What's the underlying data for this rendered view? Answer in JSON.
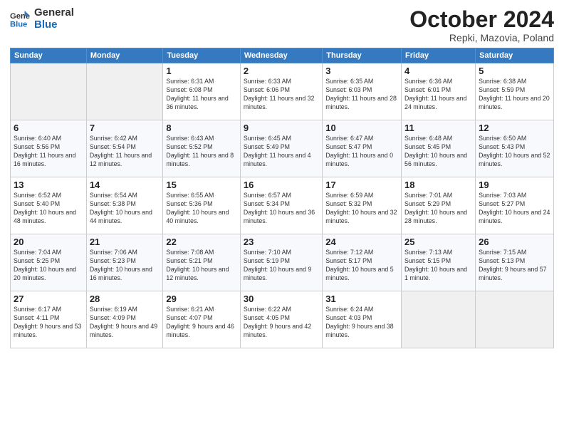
{
  "header": {
    "logo_line1": "General",
    "logo_line2": "Blue",
    "title": "October 2024",
    "subtitle": "Repki, Mazovia, Poland"
  },
  "calendar": {
    "days_of_week": [
      "Sunday",
      "Monday",
      "Tuesday",
      "Wednesday",
      "Thursday",
      "Friday",
      "Saturday"
    ],
    "weeks": [
      [
        {
          "day": "",
          "sunrise": "",
          "sunset": "",
          "daylight": "",
          "empty": true
        },
        {
          "day": "",
          "sunrise": "",
          "sunset": "",
          "daylight": "",
          "empty": true
        },
        {
          "day": "1",
          "sunrise": "Sunrise: 6:31 AM",
          "sunset": "Sunset: 6:08 PM",
          "daylight": "Daylight: 11 hours and 36 minutes.",
          "empty": false
        },
        {
          "day": "2",
          "sunrise": "Sunrise: 6:33 AM",
          "sunset": "Sunset: 6:06 PM",
          "daylight": "Daylight: 11 hours and 32 minutes.",
          "empty": false
        },
        {
          "day": "3",
          "sunrise": "Sunrise: 6:35 AM",
          "sunset": "Sunset: 6:03 PM",
          "daylight": "Daylight: 11 hours and 28 minutes.",
          "empty": false
        },
        {
          "day": "4",
          "sunrise": "Sunrise: 6:36 AM",
          "sunset": "Sunset: 6:01 PM",
          "daylight": "Daylight: 11 hours and 24 minutes.",
          "empty": false
        },
        {
          "day": "5",
          "sunrise": "Sunrise: 6:38 AM",
          "sunset": "Sunset: 5:59 PM",
          "daylight": "Daylight: 11 hours and 20 minutes.",
          "empty": false
        }
      ],
      [
        {
          "day": "6",
          "sunrise": "Sunrise: 6:40 AM",
          "sunset": "Sunset: 5:56 PM",
          "daylight": "Daylight: 11 hours and 16 minutes.",
          "empty": false
        },
        {
          "day": "7",
          "sunrise": "Sunrise: 6:42 AM",
          "sunset": "Sunset: 5:54 PM",
          "daylight": "Daylight: 11 hours and 12 minutes.",
          "empty": false
        },
        {
          "day": "8",
          "sunrise": "Sunrise: 6:43 AM",
          "sunset": "Sunset: 5:52 PM",
          "daylight": "Daylight: 11 hours and 8 minutes.",
          "empty": false
        },
        {
          "day": "9",
          "sunrise": "Sunrise: 6:45 AM",
          "sunset": "Sunset: 5:49 PM",
          "daylight": "Daylight: 11 hours and 4 minutes.",
          "empty": false
        },
        {
          "day": "10",
          "sunrise": "Sunrise: 6:47 AM",
          "sunset": "Sunset: 5:47 PM",
          "daylight": "Daylight: 11 hours and 0 minutes.",
          "empty": false
        },
        {
          "day": "11",
          "sunrise": "Sunrise: 6:48 AM",
          "sunset": "Sunset: 5:45 PM",
          "daylight": "Daylight: 10 hours and 56 minutes.",
          "empty": false
        },
        {
          "day": "12",
          "sunrise": "Sunrise: 6:50 AM",
          "sunset": "Sunset: 5:43 PM",
          "daylight": "Daylight: 10 hours and 52 minutes.",
          "empty": false
        }
      ],
      [
        {
          "day": "13",
          "sunrise": "Sunrise: 6:52 AM",
          "sunset": "Sunset: 5:40 PM",
          "daylight": "Daylight: 10 hours and 48 minutes.",
          "empty": false
        },
        {
          "day": "14",
          "sunrise": "Sunrise: 6:54 AM",
          "sunset": "Sunset: 5:38 PM",
          "daylight": "Daylight: 10 hours and 44 minutes.",
          "empty": false
        },
        {
          "day": "15",
          "sunrise": "Sunrise: 6:55 AM",
          "sunset": "Sunset: 5:36 PM",
          "daylight": "Daylight: 10 hours and 40 minutes.",
          "empty": false
        },
        {
          "day": "16",
          "sunrise": "Sunrise: 6:57 AM",
          "sunset": "Sunset: 5:34 PM",
          "daylight": "Daylight: 10 hours and 36 minutes.",
          "empty": false
        },
        {
          "day": "17",
          "sunrise": "Sunrise: 6:59 AM",
          "sunset": "Sunset: 5:32 PM",
          "daylight": "Daylight: 10 hours and 32 minutes.",
          "empty": false
        },
        {
          "day": "18",
          "sunrise": "Sunrise: 7:01 AM",
          "sunset": "Sunset: 5:29 PM",
          "daylight": "Daylight: 10 hours and 28 minutes.",
          "empty": false
        },
        {
          "day": "19",
          "sunrise": "Sunrise: 7:03 AM",
          "sunset": "Sunset: 5:27 PM",
          "daylight": "Daylight: 10 hours and 24 minutes.",
          "empty": false
        }
      ],
      [
        {
          "day": "20",
          "sunrise": "Sunrise: 7:04 AM",
          "sunset": "Sunset: 5:25 PM",
          "daylight": "Daylight: 10 hours and 20 minutes.",
          "empty": false
        },
        {
          "day": "21",
          "sunrise": "Sunrise: 7:06 AM",
          "sunset": "Sunset: 5:23 PM",
          "daylight": "Daylight: 10 hours and 16 minutes.",
          "empty": false
        },
        {
          "day": "22",
          "sunrise": "Sunrise: 7:08 AM",
          "sunset": "Sunset: 5:21 PM",
          "daylight": "Daylight: 10 hours and 12 minutes.",
          "empty": false
        },
        {
          "day": "23",
          "sunrise": "Sunrise: 7:10 AM",
          "sunset": "Sunset: 5:19 PM",
          "daylight": "Daylight: 10 hours and 9 minutes.",
          "empty": false
        },
        {
          "day": "24",
          "sunrise": "Sunrise: 7:12 AM",
          "sunset": "Sunset: 5:17 PM",
          "daylight": "Daylight: 10 hours and 5 minutes.",
          "empty": false
        },
        {
          "day": "25",
          "sunrise": "Sunrise: 7:13 AM",
          "sunset": "Sunset: 5:15 PM",
          "daylight": "Daylight: 10 hours and 1 minute.",
          "empty": false
        },
        {
          "day": "26",
          "sunrise": "Sunrise: 7:15 AM",
          "sunset": "Sunset: 5:13 PM",
          "daylight": "Daylight: 9 hours and 57 minutes.",
          "empty": false
        }
      ],
      [
        {
          "day": "27",
          "sunrise": "Sunrise: 6:17 AM",
          "sunset": "Sunset: 4:11 PM",
          "daylight": "Daylight: 9 hours and 53 minutes.",
          "empty": false
        },
        {
          "day": "28",
          "sunrise": "Sunrise: 6:19 AM",
          "sunset": "Sunset: 4:09 PM",
          "daylight": "Daylight: 9 hours and 49 minutes.",
          "empty": false
        },
        {
          "day": "29",
          "sunrise": "Sunrise: 6:21 AM",
          "sunset": "Sunset: 4:07 PM",
          "daylight": "Daylight: 9 hours and 46 minutes.",
          "empty": false
        },
        {
          "day": "30",
          "sunrise": "Sunrise: 6:22 AM",
          "sunset": "Sunset: 4:05 PM",
          "daylight": "Daylight: 9 hours and 42 minutes.",
          "empty": false
        },
        {
          "day": "31",
          "sunrise": "Sunrise: 6:24 AM",
          "sunset": "Sunset: 4:03 PM",
          "daylight": "Daylight: 9 hours and 38 minutes.",
          "empty": false
        },
        {
          "day": "",
          "sunrise": "",
          "sunset": "",
          "daylight": "",
          "empty": true
        },
        {
          "day": "",
          "sunrise": "",
          "sunset": "",
          "daylight": "",
          "empty": true
        }
      ]
    ]
  }
}
